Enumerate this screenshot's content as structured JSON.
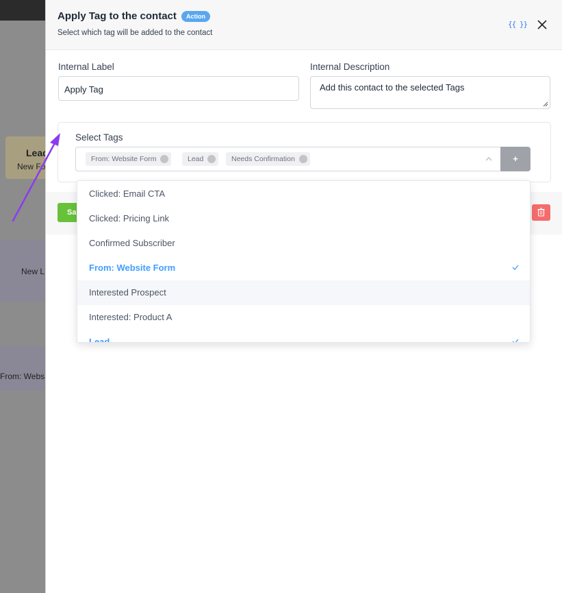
{
  "background": {
    "lead_card": {
      "title": "Lead",
      "subtitle": "New Fo"
    },
    "new_lead_text": "New L",
    "website_text": "From: Webs"
  },
  "panel": {
    "title": "Apply Tag to the contact",
    "badge": "Action",
    "subtitle": "Select which tag will be added to the contact",
    "code_icon_text": "{{ }}"
  },
  "form": {
    "internal_label": {
      "label": "Internal Label",
      "value": "Apply Tag"
    },
    "internal_description": {
      "label": "Internal Description",
      "value": "Add this contact to the selected Tags"
    },
    "select_tags": {
      "label": "Select Tags",
      "selected": [
        "From: Website Form",
        "Lead",
        "Needs Confirmation"
      ],
      "add_button": "+"
    }
  },
  "footer": {
    "save_label": "Sa"
  },
  "dropdown": {
    "items": [
      {
        "label": "Clicked: Email CTA",
        "selected": false
      },
      {
        "label": "Clicked: Pricing Link",
        "selected": false
      },
      {
        "label": "Confirmed Subscriber",
        "selected": false
      },
      {
        "label": "From: Website Form",
        "selected": true
      },
      {
        "label": "Interested Prospect",
        "selected": false
      },
      {
        "label": "Interested: Product A",
        "selected": false
      },
      {
        "label": "Lead",
        "selected": true
      }
    ]
  },
  "colors": {
    "accent": "#409eff",
    "badge": "#5aa7ef",
    "save": "#67c23a",
    "delete": "#f56c6c",
    "arrow": "#8b3bf0"
  }
}
